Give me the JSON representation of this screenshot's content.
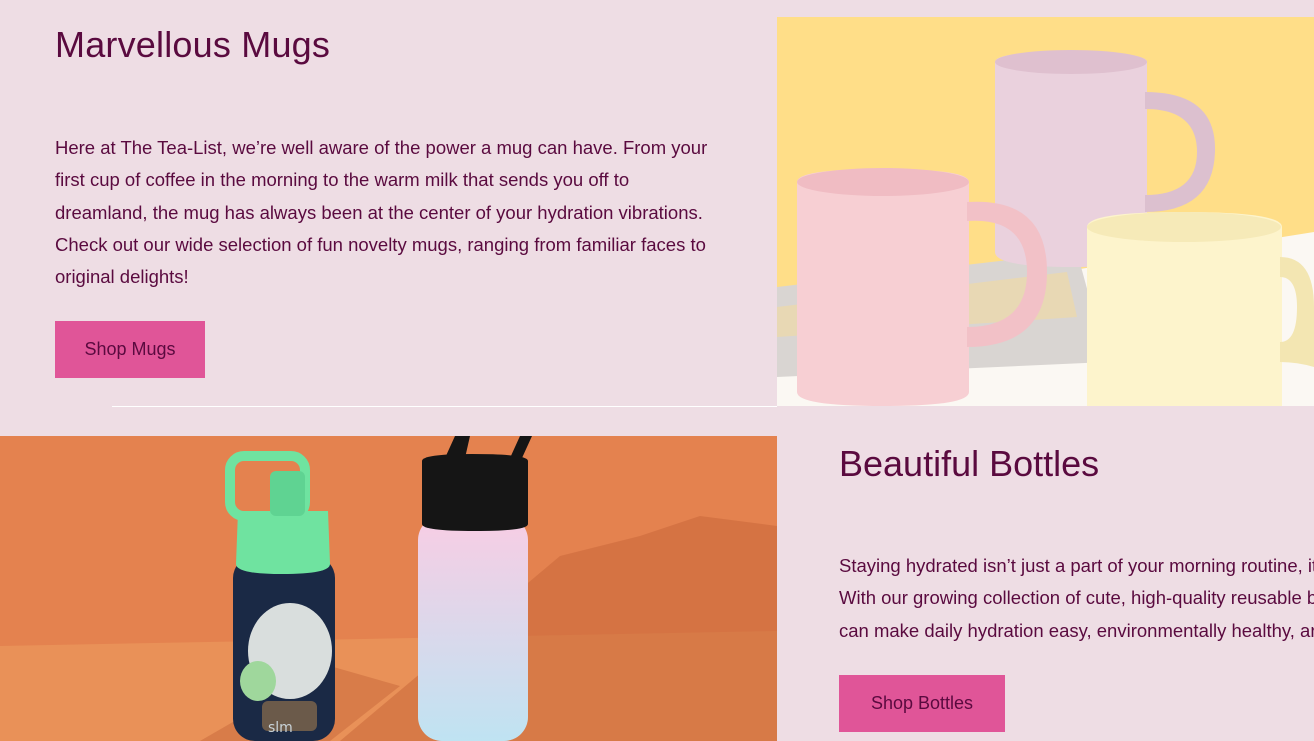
{
  "mugs_section": {
    "title": "Marvellous Mugs",
    "description": "Here at The Tea-List, we’re well aware of the power a mug can have. From your first cup of coffee in the morning to the warm milk that sends you off to dreamland, the mug has always been at the center of your hydration vibrations. Check out our wide selection of fun novelty mugs, ranging from familiar faces to original delights!",
    "button_label": "Shop Mugs",
    "image_colors": {
      "background": "#ffde88",
      "pink_mug": "#f7cfd3",
      "lilac_mug": "#e9cfdc",
      "cream_mug": "#fdf4cc"
    }
  },
  "bottles_section": {
    "title": "Beautiful Bottles",
    "description_lines": [
      "Staying hydrated isn’t just a part of your morning routine, it",
      "With our growing collection of cute, high-quality reusable b",
      "can make daily hydration easy, environmentally healthy, and"
    ],
    "button_label": "Shop Bottles",
    "bottle_brand_mark": "slm",
    "image_colors": {
      "background": "#e4824f",
      "navy_bottle": "#1a2945",
      "green_lid": "#6fe3a0",
      "gradient_bottle_top": "#f8cde4",
      "gradient_bottle_bottom": "#bfe3f2"
    }
  },
  "theme": {
    "page_background": "#eedde4",
    "text_color": "#5a0a3f",
    "button_color": "#e05598"
  }
}
